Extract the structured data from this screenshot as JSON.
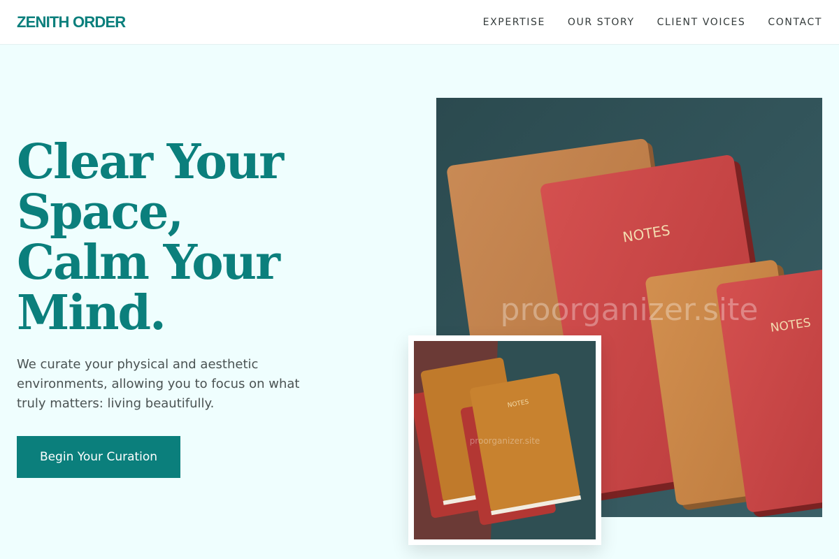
{
  "header": {
    "logo": "ZENITH ORDER",
    "nav": [
      "EXPERTISE",
      "OUR STORY",
      "CLIENT VOICES",
      "CONTACT"
    ]
  },
  "hero": {
    "headline_lines": [
      "Clear Your",
      "Space,",
      "Calm Your",
      "Mind."
    ],
    "subtext": "We curate your physical and aesthetic environments, allowing you to focus on what truly matters: living beautifully.",
    "cta_label": "Begin Your Curation"
  },
  "images": {
    "main": {
      "cover_label_1": "NOTES",
      "cover_label_2": "NOTES",
      "watermark": "proorganizer.site"
    },
    "inset": {
      "cover_label": "NOTES",
      "watermark": "proorganizer.site"
    }
  },
  "colors": {
    "brand": "#0b7f7c",
    "background": "#effefe"
  }
}
